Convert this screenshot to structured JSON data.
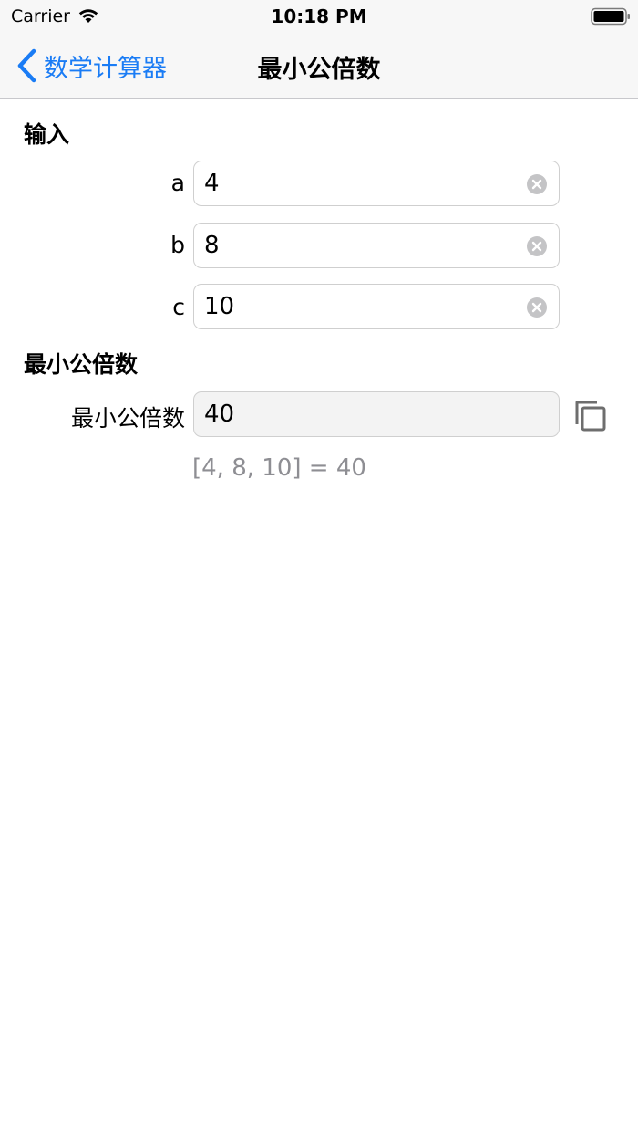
{
  "status_bar": {
    "carrier": "Carrier",
    "time": "10:18 PM",
    "icons": [
      "wifi-icon",
      "battery-icon"
    ]
  },
  "nav": {
    "back_label": "数学计算器",
    "title": "最小公倍数",
    "accent_color": "#1a7cf5"
  },
  "input_section": {
    "header": "输入",
    "fields": [
      {
        "label": "a",
        "value": "4"
      },
      {
        "label": "b",
        "value": "8"
      },
      {
        "label": "c",
        "value": "10"
      }
    ]
  },
  "result_section": {
    "header": "最小公倍数",
    "label": "最小公倍数",
    "value": "40",
    "formula": "[4, 8, 10] = 40",
    "icons": [
      "copy-icon"
    ]
  }
}
